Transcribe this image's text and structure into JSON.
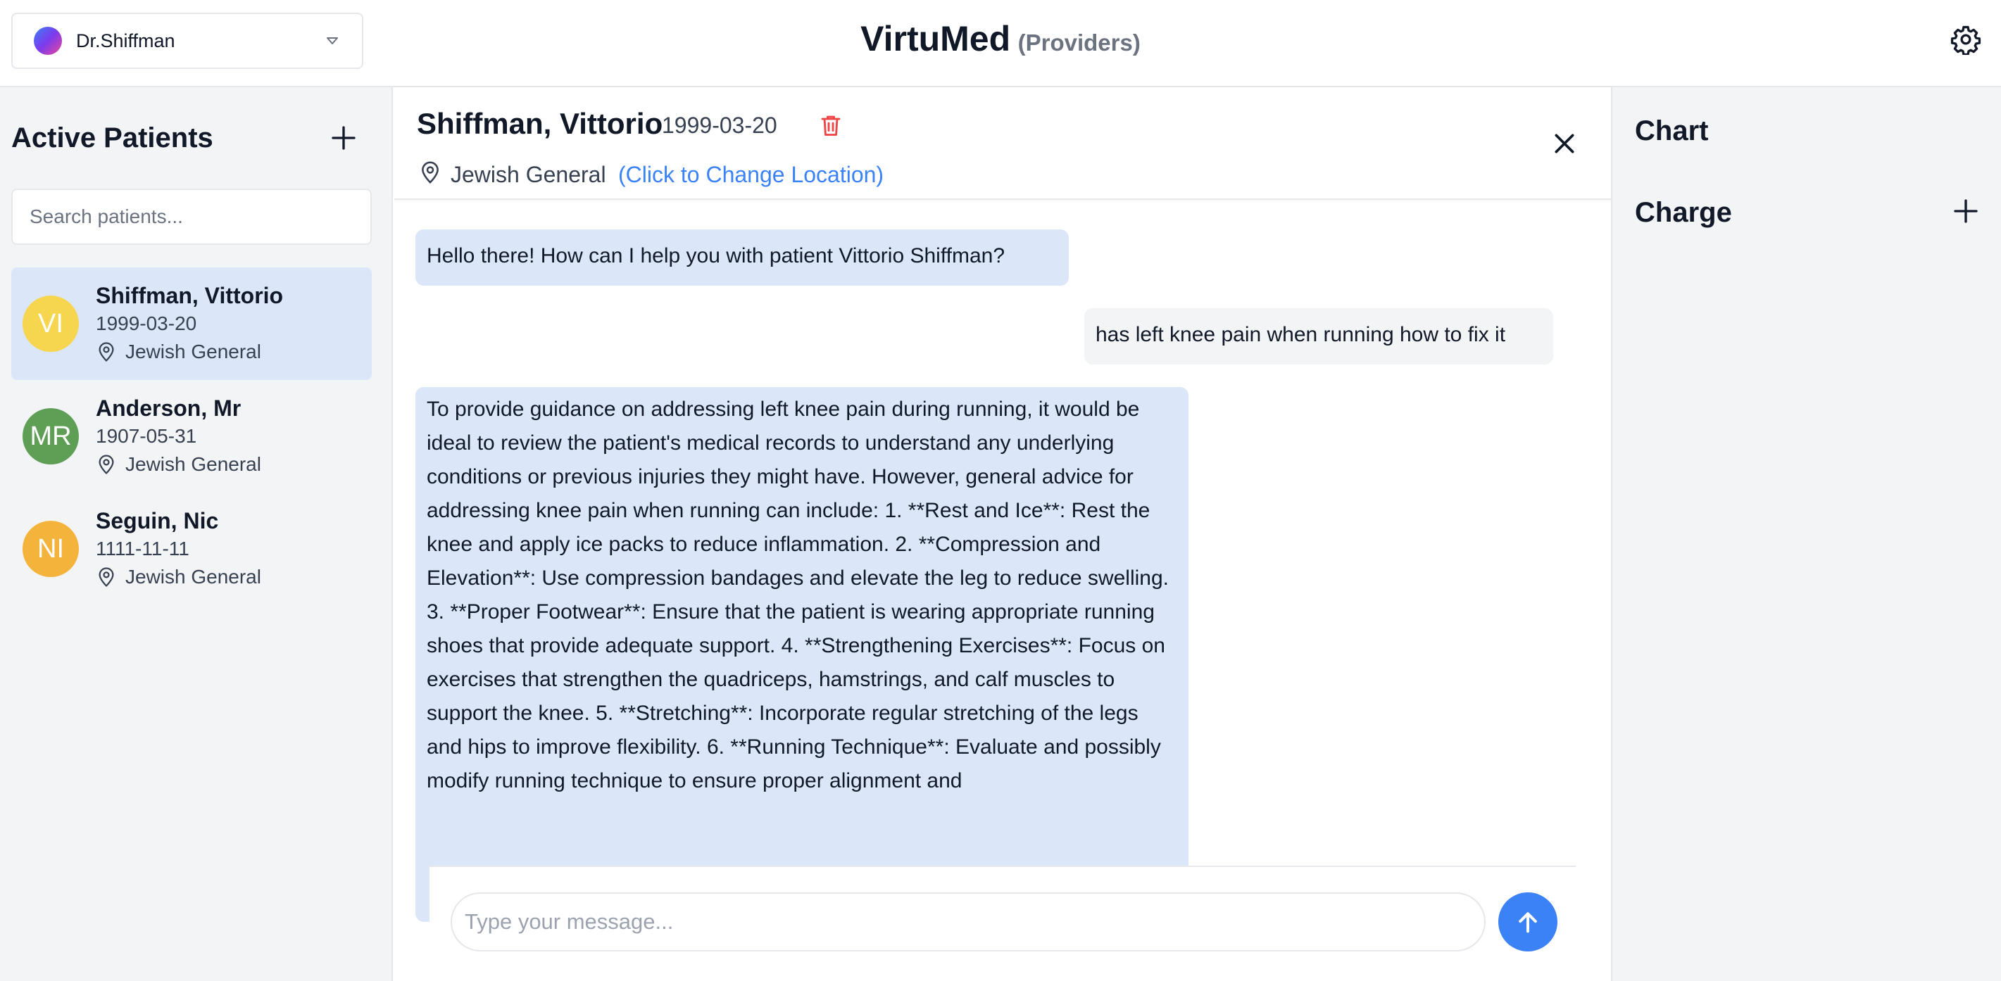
{
  "header": {
    "user": "Dr.Shiffman",
    "title": "VirtuMed",
    "subtitle": "(Providers)"
  },
  "sidebar": {
    "title": "Active Patients",
    "search_placeholder": "Search patients...",
    "patients": [
      {
        "initials": "VI",
        "name": "Shiffman, Vittorio",
        "dob": "1999-03-20",
        "location": "Jewish General",
        "color": "#f6d54f",
        "active": true
      },
      {
        "initials": "MR",
        "name": "Anderson, Mr",
        "dob": "1907-05-31",
        "location": "Jewish General",
        "color": "#5f9f55",
        "active": false
      },
      {
        "initials": "NI",
        "name": "Seguin, Nic",
        "dob": "1111-11-11",
        "location": "Jewish General",
        "color": "#f4b43b",
        "active": false
      }
    ]
  },
  "patient_header": {
    "name": "Shiffman, Vittorio",
    "dob": "1999-03-20",
    "location": "Jewish General",
    "change_location": "(Click to Change Location)"
  },
  "messages": [
    {
      "role": "assistant",
      "text": "Hello there! How can I help you with patient Vittorio Shiffman?"
    },
    {
      "role": "user",
      "text": "has left knee pain when running how to fix it"
    },
    {
      "role": "assistant",
      "text": "To provide guidance on addressing left knee pain during running, it would be ideal to review the patient's medical records to understand any underlying conditions or previous injuries they might have. However, general advice for addressing knee pain when running can include: 1. **Rest and Ice**: Rest the knee and apply ice packs to reduce inflammation. 2. **Compression and Elevation**: Use compression bandages and elevate the leg to reduce swelling. 3. **Proper Footwear**: Ensure that the patient is wearing appropriate running shoes that provide adequate support. 4. **Strengthening Exercises**: Focus on exercises that strengthen the quadriceps, hamstrings, and calf muscles to support the knee. 5. **Stretching**: Incorporate regular stretching of the legs and hips to improve flexibility. 6. **Running Technique**: Evaluate and possibly modify running technique to ensure proper alignment and"
    }
  ],
  "composer": {
    "placeholder": "Type your message..."
  },
  "right_panel": {
    "chart": "Chart",
    "charge": "Charge"
  },
  "colors": {
    "accent": "#3b82f6",
    "delete": "#ef4444",
    "selected_bg": "#dbe7f8"
  }
}
